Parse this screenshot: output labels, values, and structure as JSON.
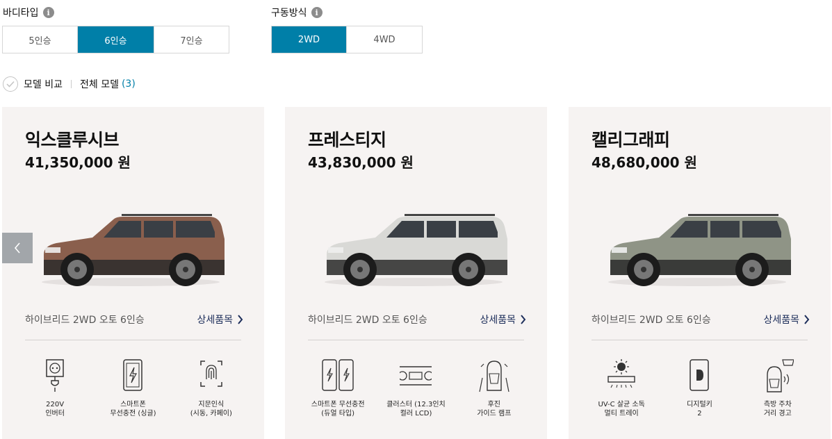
{
  "filters": {
    "body_type": {
      "label": "바디타입",
      "options": [
        "5인승",
        "6인승",
        "7인승"
      ],
      "selected": "6인승"
    },
    "drive": {
      "label": "구동방식",
      "options": [
        "2WD",
        "4WD"
      ],
      "selected": "2WD"
    }
  },
  "compare": {
    "label": "모델 비교",
    "all_models_label": "전체 모델",
    "count": "(3)"
  },
  "cards": [
    {
      "title": "익스클루시브",
      "price": "41,350,000 원",
      "subtitle": "하이브리드 2WD 오토 6인승",
      "detail_label": "상세품목",
      "car_color": "#8a5f4d",
      "features": [
        {
          "icon": "outlet-icon",
          "text": "220V\n인버터"
        },
        {
          "icon": "phone-charging-icon",
          "text": "스마트폰\n무선충전 (싱글)"
        },
        {
          "icon": "fingerprint-icon",
          "text": "지문인식\n(시동, 카페이)"
        }
      ]
    },
    {
      "title": "프레스티지",
      "price": "43,830,000 원",
      "subtitle": "하이브리드 2WD 오토 6인승",
      "detail_label": "상세품목",
      "car_color": "#d9d9d6",
      "features": [
        {
          "icon": "dual-phone-charging-icon",
          "text": "스마트폰 무선충전\n(듀얼 타입)"
        },
        {
          "icon": "cluster-icon",
          "text": "클러스터 (12.3인치\n컬러 LCD)"
        },
        {
          "icon": "rear-guide-lamp-icon",
          "text": "후진\n가이드 램프"
        }
      ]
    },
    {
      "title": "캘리그래피",
      "price": "48,680,000 원",
      "subtitle": "하이브리드 2WD 오토 6인승",
      "detail_label": "상세품목",
      "car_color": "#8f9486",
      "features": [
        {
          "icon": "uv-sterilizer-icon",
          "text": "UV-C 살균 소독\n멀티 트레이"
        },
        {
          "icon": "digital-key-icon",
          "text": "디지털키\n2"
        },
        {
          "icon": "parking-distance-icon",
          "text": "측방 주차\n거리 경고"
        }
      ]
    }
  ]
}
